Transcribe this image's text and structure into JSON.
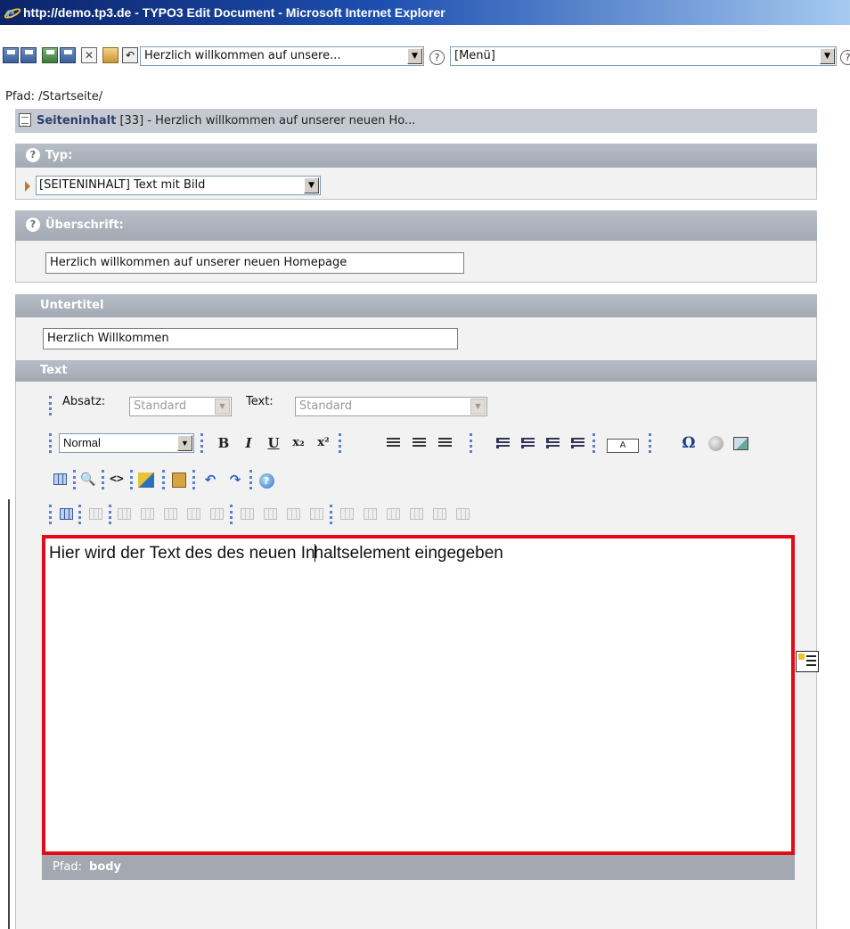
{
  "window": {
    "title": "http://demo.tp3.de - TYPO3 Edit Document - Microsoft Internet Explorer"
  },
  "toolbar": {
    "record_select_value": "Herzlich willkommen auf unsere...",
    "menu_select_value": "[Menü]",
    "help_symbol": "?"
  },
  "path": {
    "label": "Pfad: /Startseite/"
  },
  "content_header": {
    "type_label": "Seiteninhalt",
    "rest": " [33] - Herzlich willkommen auf unserer neuen Ho..."
  },
  "typ": {
    "label": "Typ:",
    "value": "[SEITENINHALT] Text mit Bild"
  },
  "ueberschrift": {
    "label": "Überschrift:",
    "value": "Herzlich willkommen auf unserer neuen Homepage"
  },
  "untertitel": {
    "label": "Untertitel",
    "value": "Herzlich Willkommen"
  },
  "text_section": {
    "label": "Text",
    "absatz_label": "Absatz:",
    "absatz_value": "Standard",
    "text_label": "Text:",
    "text_value": "Standard",
    "block_style": "Normal",
    "btn_bold": "B",
    "btn_italic": "I",
    "btn_underline": "U",
    "btn_sub": "x₂",
    "btn_sup": "x²",
    "btn_color": "A",
    "btn_omega": "Ω",
    "btn_find": "🔍",
    "btn_source": "<>",
    "btn_undo": "↶",
    "btn_redo": "↷",
    "btn_help": "?"
  },
  "editor": {
    "content_before_caret": "Hier wird der Text des des neuen In",
    "content_after_caret": "haltselement eingegeben"
  },
  "status": {
    "path_label": "Pfad:",
    "path_value": "body"
  },
  "colors": {
    "section_header": "#a8aeb8",
    "editor_border": "#e30b17",
    "titlebar": "#0b246a"
  }
}
